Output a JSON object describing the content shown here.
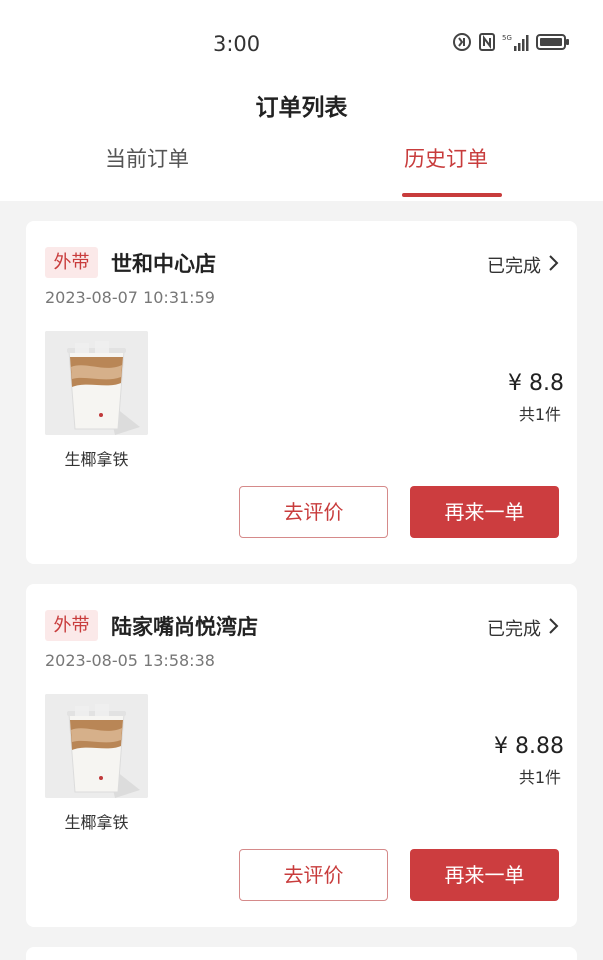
{
  "status_bar": {
    "time": "3:00"
  },
  "header": {
    "title": "订单列表"
  },
  "tabs": [
    {
      "label": "当前订单",
      "active": false
    },
    {
      "label": "历史订单",
      "active": true
    }
  ],
  "orders": [
    {
      "badge": "外带",
      "store": "世和中心店",
      "status": "已完成",
      "datetime": "2023-08-07 10:31:59",
      "item_name": "生椰拿铁",
      "price": "¥ 8.8",
      "count": "共1件",
      "review_label": "去评价",
      "reorder_label": "再来一单"
    },
    {
      "badge": "外带",
      "store": "陆家嘴尚悦湾店",
      "status": "已完成",
      "datetime": "2023-08-05 13:58:38",
      "item_name": "生椰拿铁",
      "price": "¥ 8.88",
      "count": "共1件",
      "review_label": "去评价",
      "reorder_label": "再来一单"
    }
  ],
  "colors": {
    "accent": "#c83c3c",
    "badge_bg": "#fbe9e9",
    "button_fill": "#cc3d3f"
  },
  "icons": [
    "nfc-icon",
    "network-icon",
    "signal-icon",
    "battery-icon",
    "chevron-right-icon"
  ]
}
